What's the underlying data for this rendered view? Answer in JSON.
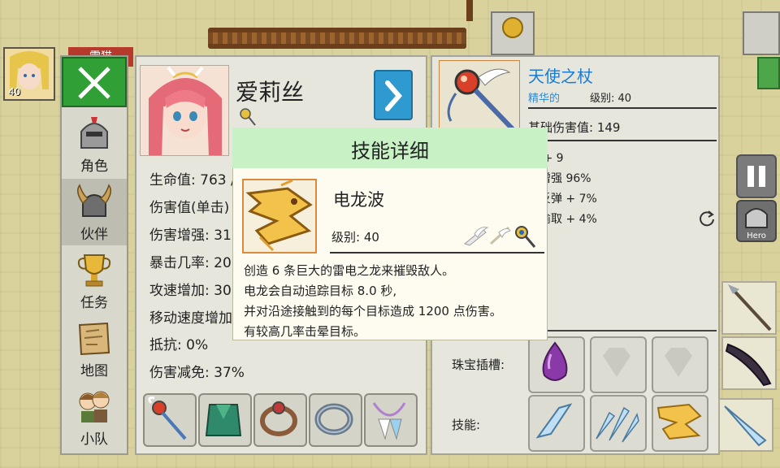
{
  "hud": {
    "hero_level": "40",
    "hero_name_tab": "雷猫"
  },
  "menu": {
    "items": [
      {
        "label": "角色",
        "icon": "helmet-icon"
      },
      {
        "label": "伙伴",
        "icon": "horned-helmet-icon"
      },
      {
        "label": "任务",
        "icon": "trophy-icon"
      },
      {
        "label": "地图",
        "icon": "scroll-map-icon"
      },
      {
        "label": "小队",
        "icon": "party-icon"
      }
    ],
    "active_index": 1
  },
  "character": {
    "name": "爱莉丝",
    "stats": [
      "生命值: 763 /",
      "伤害值(单击)",
      "伤害增强: 31",
      "暴击几率: 20",
      "攻速增加: 30",
      "移动速度增加",
      "抵抗: 0%",
      "伤害减免: 37%"
    ]
  },
  "item": {
    "name": "天使之杖",
    "quality": "精华的",
    "level": "级别: 40",
    "base_damage": "基础伤害值: 149",
    "bonuses": [
      "力 + 9",
      "害增强 96%",
      "害反弹 + 7%",
      "命偷取 + 4%"
    ],
    "gem_slots_label": "珠宝插槽:",
    "skills_label": "技能:"
  },
  "popup": {
    "title": "技能详细",
    "skill_name": "电龙波",
    "skill_level": "级别: 40",
    "description": [
      "创造 6 条巨大的雷电之龙来摧毁敌人。",
      "电龙会自动追踪目标 8.0 秒,",
      "并对沿途接触到的每个目标造成 1200 点伤害。",
      "有较高几率击晕目标。"
    ]
  },
  "right_hud": {
    "hero_button": "Hero"
  },
  "colors": {
    "close_green": "#2f9f36",
    "popup_header": "#c8f2c6",
    "item_name_blue": "#1b7ad2",
    "next_button_blue": "#2f9ad0"
  }
}
